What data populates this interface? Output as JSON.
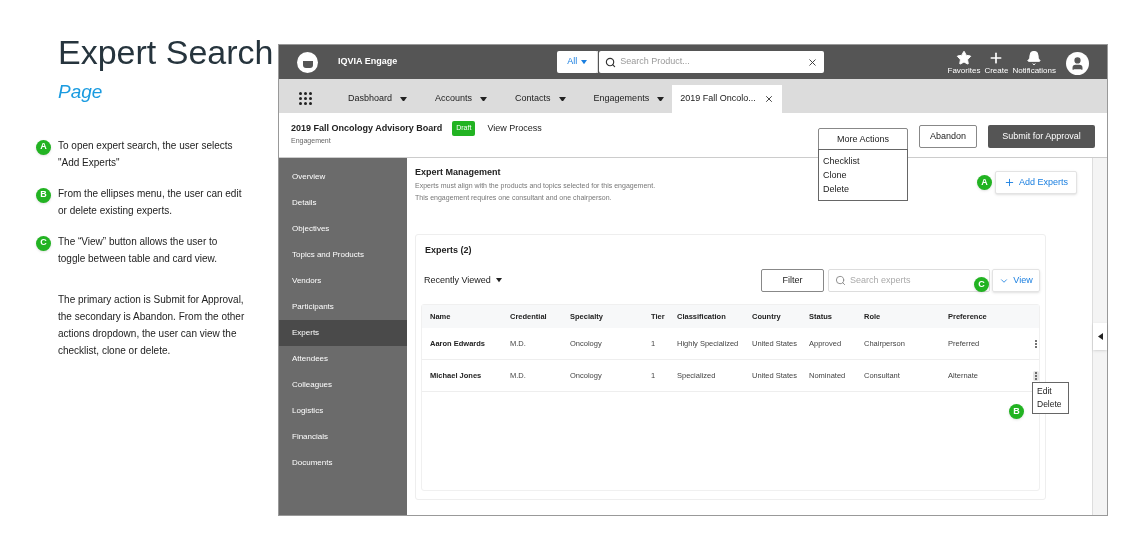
{
  "annotation": {
    "title": "Expert Search",
    "subtitle": "Page",
    "notes": [
      {
        "badge": "A",
        "text": "To open expert search, the user selects \"Add Experts\""
      },
      {
        "badge": "B",
        "text": "From the ellipses menu, the user can edit or delete existing experts."
      },
      {
        "badge": "C",
        "text": "The “View” button allows the user to toggle between table and card view."
      }
    ],
    "paragraph": "The primary action is Submit for Approval, the secondary is Abandon. From the other actions dropdown, the user can view the checklist, clone or delete."
  },
  "topbar": {
    "brand": "IQVIA Engage",
    "search": {
      "scope": "All",
      "placeholder": "Search Product..."
    },
    "actions": [
      {
        "kind": "star",
        "label": "Favorites"
      },
      {
        "kind": "plus",
        "label": "Create"
      },
      {
        "kind": "bell",
        "label": "Notifications"
      }
    ]
  },
  "nav_tabs": [
    {
      "label": "Dasbhoard",
      "kind": "menu",
      "selected": false
    },
    {
      "label": "Accounts",
      "kind": "menu",
      "selected": false
    },
    {
      "label": "Contacts",
      "kind": "menu",
      "selected": false
    },
    {
      "label": "Engagements",
      "kind": "menu",
      "selected": false
    },
    {
      "label": "2019 Fall Oncolo...",
      "kind": "record",
      "selected": true
    }
  ],
  "record": {
    "title": "2019 Fall Oncology Advisory Board",
    "status": "Draft",
    "type": "Engagement",
    "link": "View Process",
    "more_actions": {
      "label": "More Actions",
      "expanded": true,
      "items": [
        "Checklist",
        "Clone",
        "Delete"
      ]
    },
    "buttons": [
      {
        "label": "Abandon",
        "kind": "secondary"
      },
      {
        "label": "Submit for Approval",
        "kind": "primary"
      }
    ]
  },
  "sidebar": {
    "items": [
      {
        "label": "Overview",
        "selected": false
      },
      {
        "label": "Details",
        "selected": false
      },
      {
        "label": "Objectives",
        "selected": false
      },
      {
        "label": "Topics and Products",
        "selected": false
      },
      {
        "label": "Vendors",
        "selected": false
      },
      {
        "label": "Participants",
        "selected": false
      },
      {
        "label": "Experts",
        "selected": true
      },
      {
        "label": "Attendees",
        "selected": false
      },
      {
        "label": "Colleagues",
        "selected": false
      },
      {
        "label": "Logistics",
        "selected": false
      },
      {
        "label": "Financials",
        "selected": false
      },
      {
        "label": "Documents",
        "selected": false
      }
    ]
  },
  "section": {
    "title": "Expert Management",
    "lines": [
      "Experts must align with the products and topics selected for this engagement.",
      "This engagement requires one consultant and one chairperson."
    ],
    "add_button": {
      "label": "Add Experts",
      "callout": "A"
    }
  },
  "experts": {
    "title": "Experts (2)",
    "sort": "Recently Viewed",
    "filter": "Filter",
    "search_placeholder": "Search experts",
    "view_button": {
      "label": "View",
      "callout": "C"
    },
    "columns": [
      "Name",
      "Credential",
      "Specialty",
      "Tier",
      "Classification",
      "Country",
      "Status",
      "Role",
      "Preference"
    ],
    "rows": [
      {
        "cells": [
          "Aaron Edwards",
          "M.D.",
          "Oncology",
          "1",
          "Highly Specialized",
          "United States",
          "Approved",
          "Chairperson",
          "Preferred"
        ],
        "menu_open": false
      },
      {
        "cells": [
          "Michael Jones",
          "M.D.",
          "Oncology",
          "1",
          "Specialized",
          "United States",
          "Nominated",
          "Consultant",
          "Alternate"
        ],
        "menu_open": true,
        "menu": [
          "Edit",
          "Delete"
        ],
        "callout": "B"
      }
    ]
  }
}
